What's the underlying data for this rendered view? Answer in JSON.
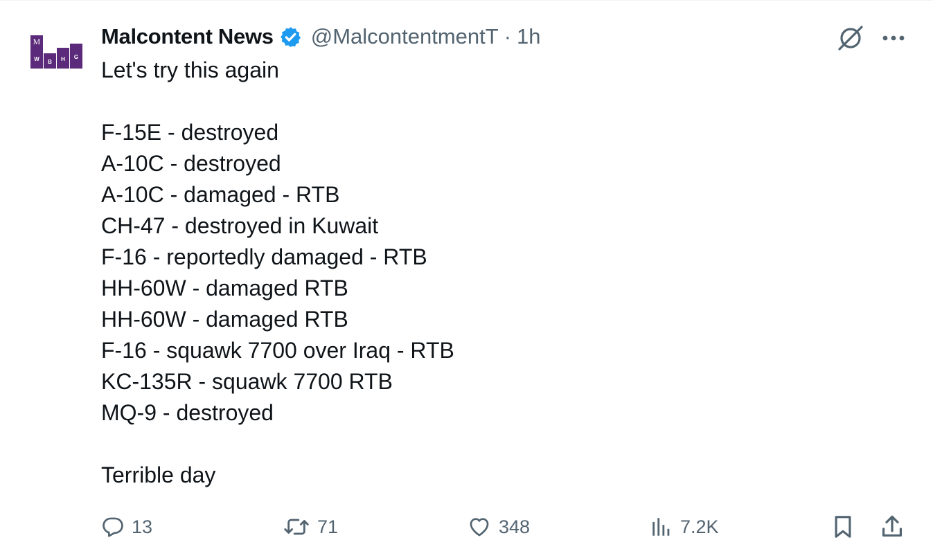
{
  "tweet": {
    "avatar_letters": [
      "M",
      "W",
      "B",
      "H",
      "G"
    ],
    "author_name": "Malcontent News",
    "handle": "@MalcontentmentT",
    "separator": "·",
    "time_ago": "1h",
    "lines": [
      "Let's try this again",
      "",
      "F-15E - destroyed",
      "A-10C - destroyed",
      "A-10C - damaged - RTB",
      "CH-47 - destroyed in Kuwait",
      "F-16 - reportedly damaged - RTB",
      "HH-60W - damaged RTB",
      "HH-60W - damaged RTB",
      "F-16 - squawk 7700 over Iraq - RTB",
      "KC-135R - squawk 7700 RTB",
      "MQ-9 - destroyed",
      "",
      "Terrible day"
    ]
  },
  "actions": {
    "replies": "13",
    "reposts": "71",
    "likes": "348",
    "views": "7.2K"
  },
  "colors": {
    "text": "#0f1419",
    "secondary": "#536471",
    "verified": "#1d9bf0",
    "avatar_purple": "#5b2a7a"
  },
  "icons": [
    "verified-badge-icon",
    "grok-icon",
    "more-icon",
    "reply-icon",
    "repost-icon",
    "like-icon",
    "views-icon",
    "bookmark-icon",
    "share-icon"
  ]
}
